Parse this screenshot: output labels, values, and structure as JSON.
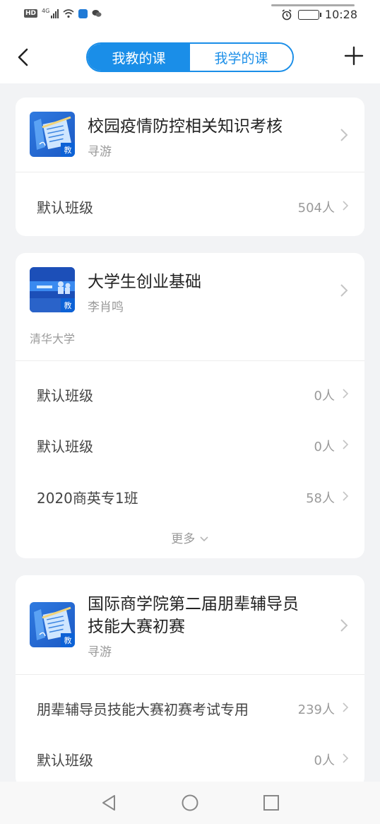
{
  "status_bar": {
    "left_icons": [
      "hd-icon",
      "signal-icon",
      "wifi-icon",
      "app-notification-icon",
      "wechat-icon"
    ],
    "hd_label": "HD",
    "net_label": "4G",
    "right_icons": [
      "alarm-icon",
      "battery-icon"
    ],
    "time": "10:28"
  },
  "header": {
    "tabs": [
      {
        "label": "我教的课",
        "active": true
      },
      {
        "label": "我学的课",
        "active": false
      }
    ],
    "back_icon": "back-arrow-icon",
    "add_icon": "plus-icon"
  },
  "accent_color": "#1a8ee8",
  "courses": [
    {
      "title": "校园疫情防控相关知识考核",
      "teacher": "寻游",
      "badge": "教",
      "classes": [
        {
          "name": "默认班级",
          "count": "504人"
        }
      ]
    },
    {
      "title": "大学生创业基础",
      "teacher": "李肖鸣",
      "school": "清华大学",
      "badge": "教",
      "classes": [
        {
          "name": "默认班级",
          "count": "0人"
        },
        {
          "name": "默认班级",
          "count": "0人"
        },
        {
          "name": "2020商英专1班",
          "count": "58人"
        }
      ],
      "more_label": "更多"
    },
    {
      "title_line1": "国际商学院第二届朋辈辅导员",
      "title_line2": "技能大赛初赛",
      "teacher": "寻游",
      "badge": "教",
      "classes": [
        {
          "name": "朋辈辅导员技能大赛初赛考试专用",
          "count": "239人"
        },
        {
          "name": "默认班级",
          "count": "0人"
        }
      ]
    }
  ],
  "nav_bar": [
    "back-triangle-icon",
    "home-circle-icon",
    "recents-square-icon"
  ]
}
